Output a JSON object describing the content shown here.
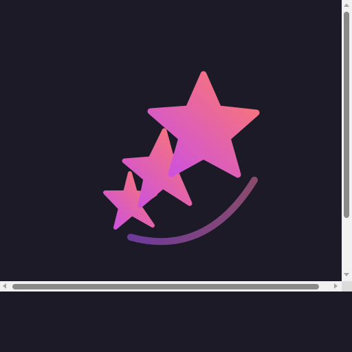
{
  "page": {
    "background": "#1b1a26",
    "scrollbar_track": "#f1f1f1",
    "scrollbar_thumb": "#8a8a8a"
  },
  "logo": {
    "icon": "shooting-stars-icon",
    "gradient_start": "#c84ee8",
    "gradient_end": "#ff7a6a",
    "trail_start": "#6d3a9a",
    "trail_end": "#8a4a6e"
  },
  "scrollbars": {
    "vertical_icon_up": "chevron-up-icon",
    "vertical_icon_down": "chevron-down-icon",
    "horizontal_icon_left": "chevron-left-icon",
    "horizontal_icon_right": "chevron-right-icon"
  }
}
